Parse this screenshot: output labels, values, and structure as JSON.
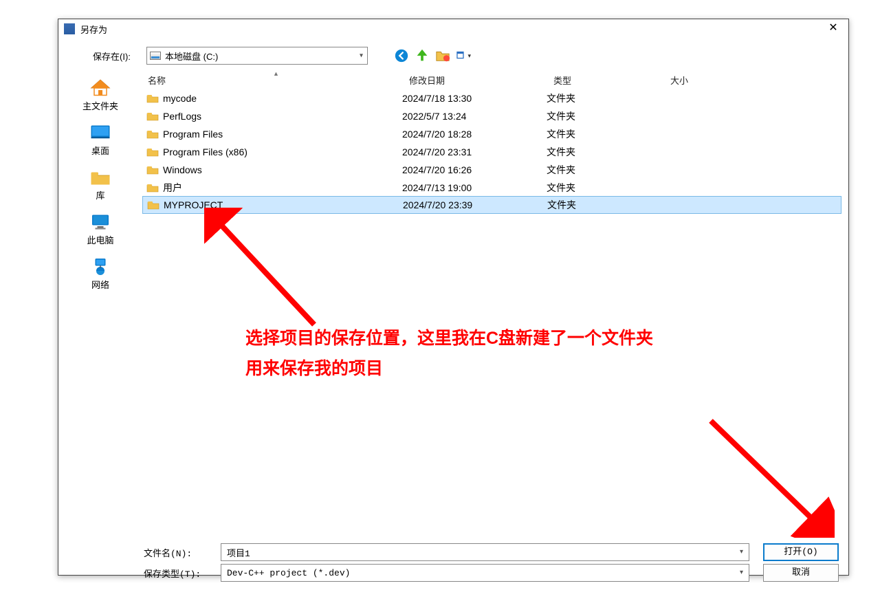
{
  "title": "另存为",
  "save_in_label": "保存在(I):",
  "location": "本地磁盘 (C:)",
  "headers": {
    "name": "名称",
    "date": "修改日期",
    "type": "类型",
    "size": "大小"
  },
  "rows": [
    {
      "name": "mycode",
      "date": "2024/7/18 13:30",
      "type": "文件夹",
      "selected": false
    },
    {
      "name": "PerfLogs",
      "date": "2022/5/7 13:24",
      "type": "文件夹",
      "selected": false
    },
    {
      "name": "Program Files",
      "date": "2024/7/20 18:28",
      "type": "文件夹",
      "selected": false
    },
    {
      "name": "Program Files (x86)",
      "date": "2024/7/20 23:31",
      "type": "文件夹",
      "selected": false
    },
    {
      "name": "Windows",
      "date": "2024/7/20 16:26",
      "type": "文件夹",
      "selected": false
    },
    {
      "name": "用户",
      "date": "2024/7/13 19:00",
      "type": "文件夹",
      "selected": false
    },
    {
      "name": "MYPROJECT",
      "date": "2024/7/20 23:39",
      "type": "文件夹",
      "selected": true
    }
  ],
  "sidebar": {
    "home": "主文件夹",
    "desktop": "桌面",
    "library": "库",
    "thispc": "此电脑",
    "network": "网络"
  },
  "filename_label": "文件名(N):",
  "filename": "项目1",
  "filetype_label": "保存类型(T):",
  "filetype": "Dev-C++ project (*.dev)",
  "open_btn": "打开(O)",
  "cancel_btn": "取消",
  "annotation": {
    "line1": "选择项目的保存位置，这里我在C盘新建了一个文件夹",
    "line2": "用来保存我的项目"
  }
}
